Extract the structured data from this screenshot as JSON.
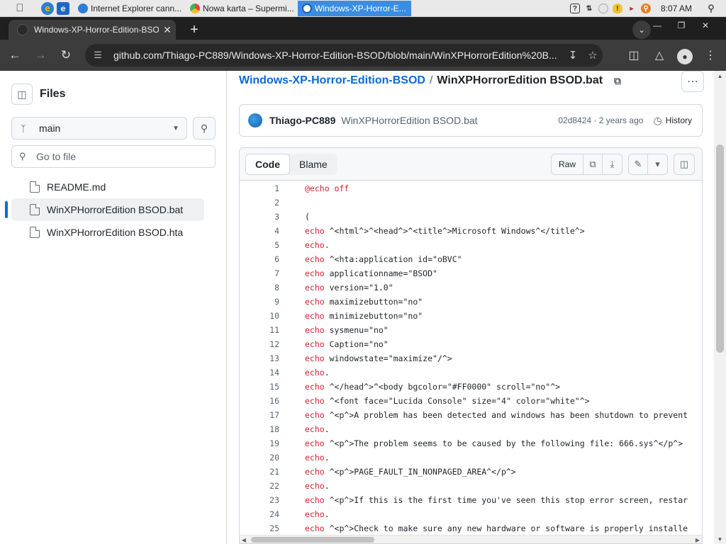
{
  "taskbar": {
    "tasks": [
      {
        "label": "Internet Explorer cann..."
      },
      {
        "label": "Nowa karta – Supermi..."
      },
      {
        "label": "Windows-XP-Horror-E..."
      }
    ],
    "time": "8:07 AM"
  },
  "browser": {
    "tab_title": "Windows-XP-Horror-Edition-BSOD/",
    "url": "github.com/Thiago-PC889/Windows-XP-Horror-Edition-BSOD/blob/main/WinXPHorrorEdition%20B..."
  },
  "sidebar": {
    "title": "Files",
    "branch": "main",
    "search_placeholder": "Go to file",
    "files": [
      {
        "name": "README.md"
      },
      {
        "name": "WinXPHorrorEdition BSOD.bat"
      },
      {
        "name": "WinXPHorrorEdition BSOD.hta"
      }
    ]
  },
  "breadcrumb": {
    "repo": "Windows-XP-Horror-Edition-BSOD",
    "separator": "/",
    "file": "WinXPHorrorEdition BSOD.bat"
  },
  "commit": {
    "author": "Thiago-PC889",
    "message": "WinXPHorrorEdition BSOD.bat",
    "meta": "02d8424 · 2 years ago",
    "history_label": "History"
  },
  "code_header": {
    "code_tab": "Code",
    "blame_tab": "Blame",
    "raw_label": "Raw"
  },
  "code_lines": [
    {
      "n": "1",
      "kw": "@echo off",
      "rest": ""
    },
    {
      "n": "2",
      "kw": "",
      "rest": ""
    },
    {
      "n": "3",
      "kw": "",
      "rest": "("
    },
    {
      "n": "4",
      "kw": "echo",
      "rest": " ^<html^>^<head^>^<title^>Microsoft Windows^</title^>"
    },
    {
      "n": "5",
      "kw": "echo",
      "rest": "."
    },
    {
      "n": "6",
      "kw": "echo",
      "rest": " ^<hta:application id=\"oBVC\""
    },
    {
      "n": "7",
      "kw": "echo",
      "rest": " applicationname=\"BSOD\""
    },
    {
      "n": "8",
      "kw": "echo",
      "rest": " version=\"1.0\""
    },
    {
      "n": "9",
      "kw": "echo",
      "rest": " maximizebutton=\"no\""
    },
    {
      "n": "10",
      "kw": "echo",
      "rest": " minimizebutton=\"no\""
    },
    {
      "n": "11",
      "kw": "echo",
      "rest": " sysmenu=\"no\""
    },
    {
      "n": "12",
      "kw": "echo",
      "rest": " Caption=\"no\""
    },
    {
      "n": "13",
      "kw": "echo",
      "rest": " windowstate=\"maximize\"/^>"
    },
    {
      "n": "14",
      "kw": "echo",
      "rest": "."
    },
    {
      "n": "15",
      "kw": "echo",
      "rest": " ^</head^>^<body bgcolor=\"#FF0000\" scroll=\"no\"^>"
    },
    {
      "n": "16",
      "kw": "echo",
      "rest": " ^<font face=\"Lucida Console\" size=\"4\" color=\"white\"^>"
    },
    {
      "n": "17",
      "kw": "echo",
      "rest": " ^<p^>A problem has been detected and windows has been shutdown to prevent"
    },
    {
      "n": "18",
      "kw": "echo",
      "rest": "."
    },
    {
      "n": "19",
      "kw": "echo",
      "rest": " ^<p^>The problem seems to be caused by the following file: 666.sys^</p^>"
    },
    {
      "n": "20",
      "kw": "echo",
      "rest": "."
    },
    {
      "n": "21",
      "kw": "echo",
      "rest": " ^<p^>PAGE_FAULT_IN_NONPAGED_AREA^</p^>"
    },
    {
      "n": "22",
      "kw": "echo",
      "rest": "."
    },
    {
      "n": "23",
      "kw": "echo",
      "rest": " ^<p^>If this is the first time you've seen this stop error screen, restar"
    },
    {
      "n": "24",
      "kw": "echo",
      "rest": "."
    },
    {
      "n": "25",
      "kw": "echo",
      "rest": " ^<p^>Check to make sure any new hardware or software is properly installe"
    }
  ],
  "colors": {
    "link": "#0969da",
    "keyword": "#cf222e",
    "active_indicator": "#0969da"
  }
}
